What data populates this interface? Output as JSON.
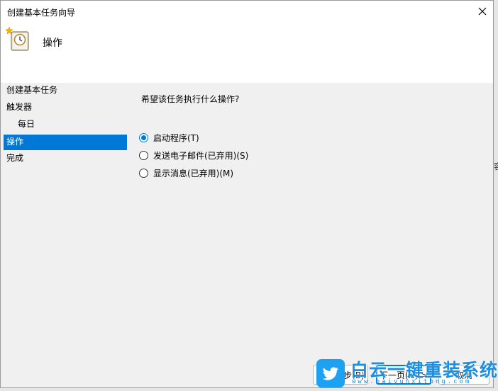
{
  "window": {
    "title": "创建基本任务向导",
    "close_glyph": "✕"
  },
  "header": {
    "title": "操作",
    "icon": "task-clock-icon"
  },
  "steps": [
    {
      "label": "创建基本任务",
      "level": 0,
      "active": false
    },
    {
      "label": "触发器",
      "level": 0,
      "active": false
    },
    {
      "label": "每日",
      "level": 1,
      "active": false
    },
    {
      "label": "操作",
      "level": 0,
      "active": true
    },
    {
      "label": "完成",
      "level": 0,
      "active": false
    }
  ],
  "content": {
    "question": "希望该任务执行什么操作?",
    "options": [
      {
        "label": "启动程序(T)",
        "checked": true
      },
      {
        "label": "发送电子邮件(已弃用)(S)",
        "checked": false
      },
      {
        "label": "显示消息(已弃用)(M)",
        "checked": false
      }
    ]
  },
  "buttons": {
    "back": "< 上一步(B)",
    "next": "下一页(N) >",
    "cancel": "取消"
  },
  "side_fragment": "容",
  "watermark": {
    "title": "白云一键重装系统",
    "url": "www.baiyunxitong.com",
    "icon": "twitter-bird-icon"
  },
  "colors": {
    "accent": "#0078d7",
    "watermark": "#1a8fe3"
  }
}
